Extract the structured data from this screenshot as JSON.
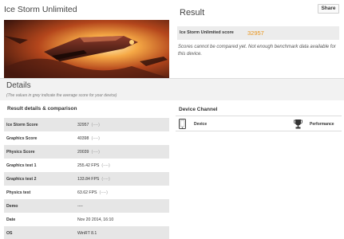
{
  "test": {
    "title": "Ice Storm Unlimited"
  },
  "result": {
    "title": "Result",
    "share_label": "Share",
    "score_label": "Ice Storm Unlimited score",
    "score_value": "32957",
    "note": "Scores cannot be compared yet. Not enough benchmark data available for this device."
  },
  "details": {
    "title": "Details",
    "hint": "(The values in grey indicate the average score for your device)"
  },
  "result_details": {
    "title": "Result details & comparison",
    "rows": [
      {
        "label": "Ice Storm Score",
        "value": "32957",
        "hint": "(----)"
      },
      {
        "label": "Graphics Score",
        "value": "40398",
        "hint": "(----)"
      },
      {
        "label": "Physics Score",
        "value": "20039",
        "hint": "(----)"
      },
      {
        "label": "Graphics test 1",
        "value": "255.42 FPS",
        "hint": "(----)"
      },
      {
        "label": "Graphics test 2",
        "value": "133.84 FPS",
        "hint": "(----)"
      },
      {
        "label": "Physics test",
        "value": "63.62 FPS",
        "hint": "(----)"
      },
      {
        "label": "Demo",
        "value": "----",
        "hint": ""
      },
      {
        "label": "Date",
        "value": "Nov 20 2014, 16:10",
        "hint": ""
      },
      {
        "label": "OS",
        "value": "WinRT 8.1",
        "hint": ""
      }
    ]
  },
  "device_channel": {
    "title": "Device Channel",
    "device_label": "Device",
    "performance_label": "Performance"
  },
  "icons": {
    "device": "tablet-icon",
    "performance": "trophy-icon"
  },
  "colors": {
    "score_accent": "#e8941a",
    "row_shade": "#e6e6e6"
  }
}
